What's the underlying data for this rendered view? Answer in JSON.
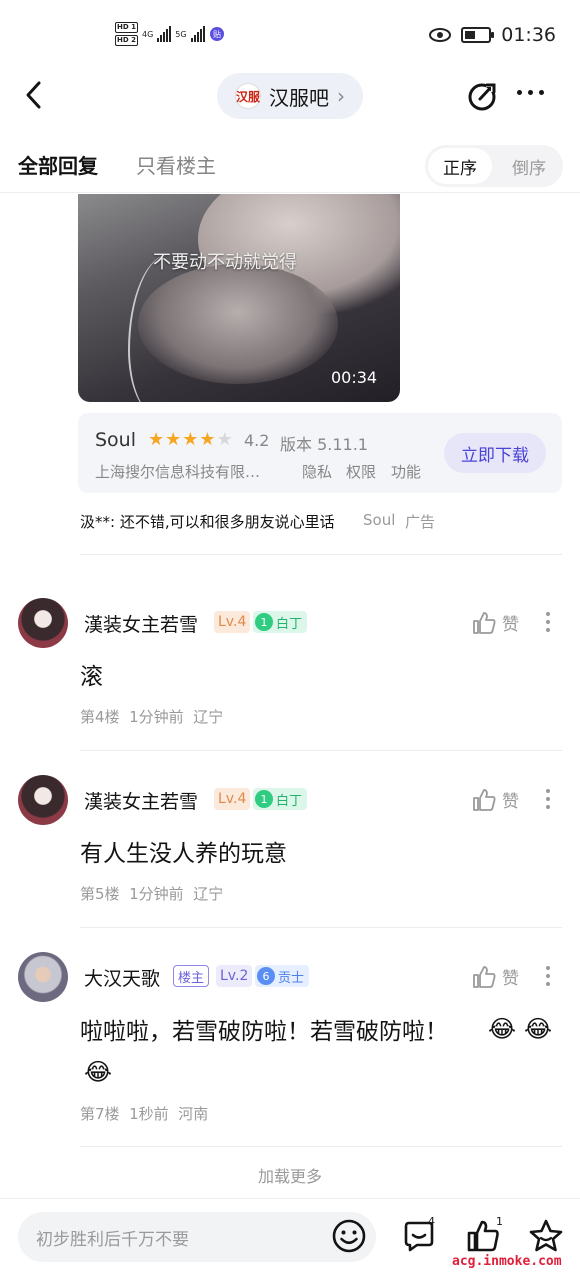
{
  "status_bar": {
    "hd1": "HD 1",
    "hd2": "HD 2",
    "net1": "4G",
    "net2": "5G",
    "time": "01:36"
  },
  "nav": {
    "bar_logo": "汉服",
    "bar_name": "汉服吧",
    "back_icon": "chevron-left-icon",
    "share_icon": "share-icon",
    "more_icon": "more-horizontal-icon"
  },
  "tabs": {
    "all_replies": "全部回复",
    "host_only": "只看楼主",
    "order_asc": "正序",
    "order_desc": "倒序"
  },
  "video": {
    "caption": "不要动不动就觉得",
    "duration": "00:34"
  },
  "ad": {
    "app_name": "Soul",
    "rating": "4.2",
    "rating_value": 4.2,
    "version": "版本 5.11.1",
    "developer": "上海搜尔信息科技有限…",
    "privacy": "隐私",
    "permissions": "权限",
    "features": "功能",
    "download": "立即下载",
    "text": "汲**: 还不错,可以和很多朋友说心里话",
    "source": "Soul",
    "tag": "广告"
  },
  "posts": [
    {
      "username": "漢装女主若雪",
      "level": "Lv.4",
      "badge_num": "1",
      "badge_name": "白丁",
      "content": "滚",
      "floor": "第4楼",
      "time": "1分钟前",
      "location": "辽宁",
      "like_label": "赞"
    },
    {
      "username": "漢装女主若雪",
      "level": "Lv.4",
      "badge_num": "1",
      "badge_name": "白丁",
      "content": "有人生没人养的玩意",
      "floor": "第5楼",
      "time": "1分钟前",
      "location": "辽宁",
      "like_label": "赞"
    },
    {
      "username": "大汉天歌",
      "host_tag": "楼主",
      "level": "Lv.2",
      "badge_num": "6",
      "badge_name": "贡士",
      "content": "啦啦啦，若雪破防啦！若雪破防啦！",
      "emoji": "😂",
      "floor": "第7楼",
      "time": "1秒前",
      "location": "河南",
      "like_label": "赞"
    }
  ],
  "load_more": "加载更多",
  "bottom_bar": {
    "input_placeholder": "初步胜利后千万不要",
    "comment_count": "4",
    "like_count": "1"
  },
  "watermark": "acg.inmoke.com",
  "colors": {
    "accent": "#4b42d6",
    "star": "#f5a623",
    "badge_green": "#24b36e",
    "badge_blue": "#4f7ee9",
    "watermark": "#e0203a"
  }
}
